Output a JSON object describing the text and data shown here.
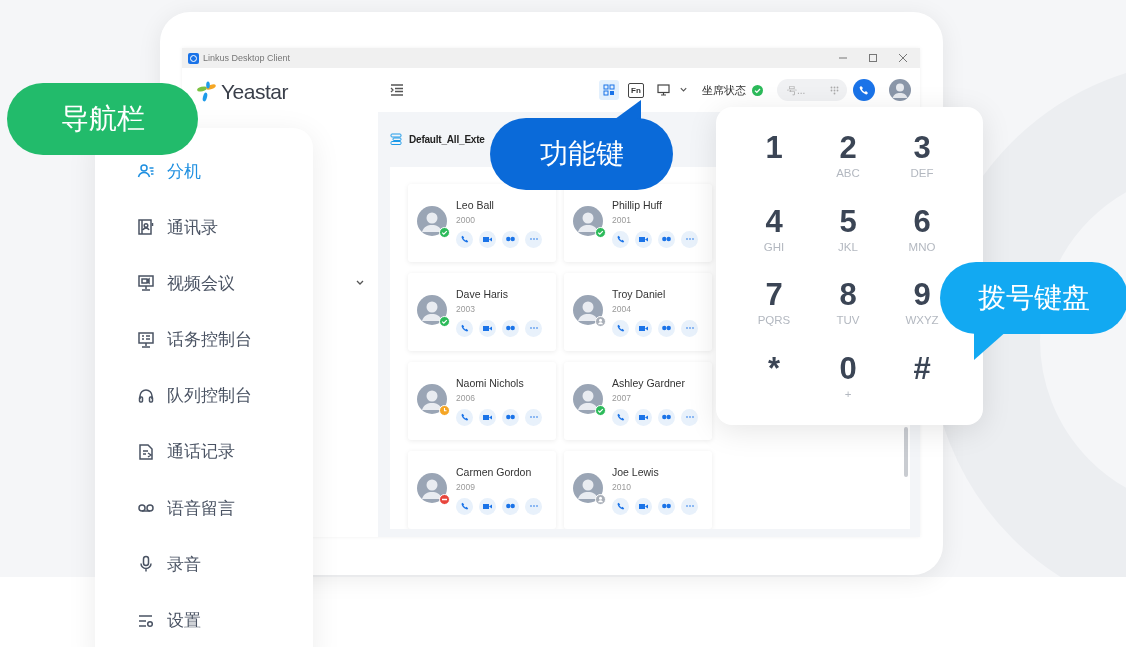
{
  "window": {
    "title": "Linkus Desktop Client"
  },
  "logo": {
    "text": "Yeastar"
  },
  "toolbar": {
    "tools": [
      {
        "kind": "qr",
        "selected": true
      },
      {
        "kind": "fn",
        "label": "Fn",
        "selected": false
      },
      {
        "kind": "monitor",
        "selected": false
      }
    ],
    "agent_status": "坐席状态",
    "search": {
      "placeholder": "号..."
    }
  },
  "group": {
    "title": "Default_All_Exte"
  },
  "contacts": [
    {
      "name": "Leo Ball",
      "ext": "2000",
      "kind": "available"
    },
    {
      "name": "Phillip Huff",
      "ext": "2001",
      "kind": "available"
    },
    {
      "name": "Dave Haris",
      "ext": "2003",
      "kind": "available"
    },
    {
      "name": "Troy Daniel",
      "ext": "2004",
      "kind": "offline"
    },
    {
      "name": "Naomi Nichols",
      "ext": "2006",
      "kind": "away"
    },
    {
      "name": "Ashley Gardner",
      "ext": "2007",
      "kind": "available"
    },
    {
      "name": "Carmen Gordon",
      "ext": "2009",
      "kind": "busy"
    },
    {
      "name": "Joe Lewis",
      "ext": "2010",
      "kind": "offline"
    }
  ],
  "nav": {
    "items": [
      {
        "label": "分机",
        "kind": "extension",
        "selected": true
      },
      {
        "label": "通讯录",
        "kind": "contacts",
        "selected": false
      },
      {
        "label": "视频会议",
        "kind": "video",
        "selected": false
      },
      {
        "label": "话务控制台",
        "kind": "console",
        "selected": false
      },
      {
        "label": "队列控制台",
        "kind": "headset",
        "selected": false
      },
      {
        "label": "通话记录",
        "kind": "calllog",
        "selected": false
      },
      {
        "label": "语音留言",
        "kind": "voicemail",
        "selected": false
      },
      {
        "label": "录音",
        "kind": "mic",
        "selected": false
      },
      {
        "label": "设置",
        "kind": "settings",
        "selected": false
      }
    ]
  },
  "dialpad": {
    "keys": [
      {
        "digit": "1"
      },
      {
        "digit": "2",
        "letters": "ABC"
      },
      {
        "digit": "3",
        "letters": "DEF"
      },
      {
        "digit": "4",
        "letters": "GHI"
      },
      {
        "digit": "5",
        "letters": "JKL"
      },
      {
        "digit": "6",
        "letters": "MNO"
      },
      {
        "digit": "7",
        "letters": "PQRS"
      },
      {
        "digit": "8",
        "letters": "TUV"
      },
      {
        "digit": "9",
        "letters": "WXYZ"
      },
      {
        "digit": "*"
      },
      {
        "digit": "0",
        "letters": "+"
      },
      {
        "digit": "#"
      }
    ]
  },
  "callouts": [
    {
      "text": "导航栏",
      "color": "#22bb6b"
    },
    {
      "text": "功能键",
      "color": "#0a6ad9"
    },
    {
      "text": "拨号键盘",
      "color": "#12a9f2"
    }
  ]
}
